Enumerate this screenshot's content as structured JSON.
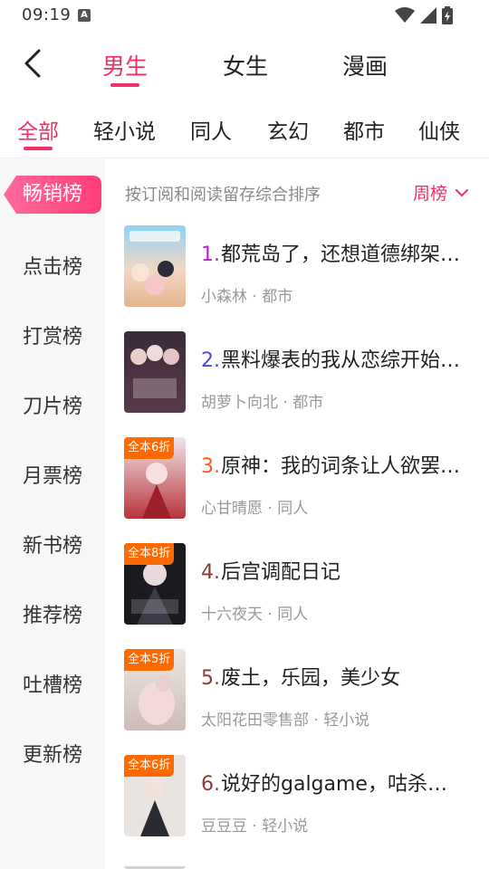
{
  "status_bar": {
    "time": "09:19",
    "a_badge": "A",
    "icons": [
      "wifi-icon",
      "signal-icon",
      "battery-icon"
    ]
  },
  "top_tabs": [
    {
      "label": "男生",
      "active": true
    },
    {
      "label": "女生",
      "active": false
    },
    {
      "label": "漫画",
      "active": false
    }
  ],
  "categories": [
    {
      "label": "全部",
      "active": true
    },
    {
      "label": "轻小说",
      "active": false
    },
    {
      "label": "同人",
      "active": false
    },
    {
      "label": "玄幻",
      "active": false
    },
    {
      "label": "都市",
      "active": false
    },
    {
      "label": "仙侠",
      "active": false
    }
  ],
  "sidebar": [
    {
      "label": "畅销榜",
      "active": true
    },
    {
      "label": "点击榜",
      "active": false
    },
    {
      "label": "打赏榜",
      "active": false
    },
    {
      "label": "刀片榜",
      "active": false
    },
    {
      "label": "月票榜",
      "active": false
    },
    {
      "label": "新书榜",
      "active": false
    },
    {
      "label": "推荐榜",
      "active": false
    },
    {
      "label": "吐槽榜",
      "active": false
    },
    {
      "label": "更新榜",
      "active": false
    }
  ],
  "sort": {
    "description": "按订阅和阅读留存综合排序",
    "period": "周榜"
  },
  "colors": {
    "accent": "#ef2f66",
    "discount": "#ff6a00",
    "rank_1": "#c21bd6",
    "rank_2": "#4a4ae0",
    "rank_3": "#ff5a1f",
    "rank_other": "#8a3a3a"
  },
  "books": [
    {
      "rank": "1.",
      "title": "都荒岛了，还想道德绑架我？",
      "author": "小森林",
      "category": "都市",
      "discount": ""
    },
    {
      "rank": "2.",
      "title": "黑料爆表的我从恋综开始爆红",
      "author": "胡萝卜向北",
      "category": "都市",
      "discount": ""
    },
    {
      "rank": "3.",
      "title": "原神：我的词条让人欲罢不能",
      "author": "心甘晴愿",
      "category": "同人",
      "discount": "全本6折"
    },
    {
      "rank": "4.",
      "title": "后宫调配日记",
      "author": "十六夜天",
      "category": "同人",
      "discount": "全本8折"
    },
    {
      "rank": "5.",
      "title": "废土，乐园，美少女",
      "author": "太阳花田零售部",
      "category": "轻小说",
      "discount": "全本5折"
    },
    {
      "rank": "6.",
      "title": "说好的galgame，咕杀我干嘛",
      "author": "豆豆豆",
      "category": "轻小说",
      "discount": "全本6折"
    }
  ]
}
